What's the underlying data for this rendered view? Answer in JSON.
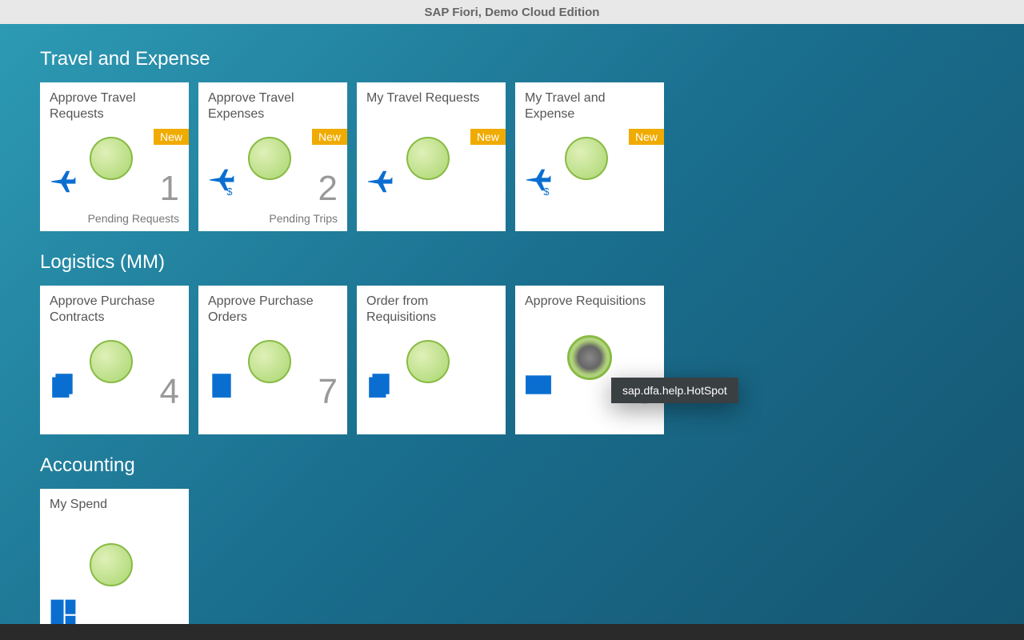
{
  "header": {
    "title": "SAP Fiori, Demo Cloud Edition"
  },
  "tooltip": "sap.dfa.help.HotSpot",
  "groups": [
    {
      "title": "Travel and Expense",
      "tiles": [
        {
          "title": "Approve Travel Requests",
          "badge": "New",
          "count": "1",
          "footer": "Pending Requests",
          "icon": "airplane"
        },
        {
          "title": "Approve Travel Expenses",
          "badge": "New",
          "count": "2",
          "footer": "Pending Trips",
          "icon": "airplane-dollar"
        },
        {
          "title": "My Travel Requests",
          "badge": "New",
          "count": "",
          "footer": "",
          "icon": "airplane"
        },
        {
          "title": "My Travel and Expense",
          "badge": "New",
          "count": "",
          "footer": "",
          "icon": "airplane-dollar"
        }
      ]
    },
    {
      "title": "Logistics (MM)",
      "tiles": [
        {
          "title": "Approve Purchase Contracts",
          "badge": "",
          "count": "4",
          "footer": "",
          "icon": "doc-dollar-stack"
        },
        {
          "title": "Approve Purchase Orders",
          "badge": "",
          "count": "7",
          "footer": "",
          "icon": "doc-dollar"
        },
        {
          "title": "Order from Requisitions",
          "badge": "",
          "count": "",
          "footer": "",
          "icon": "doc-dollar-stack"
        },
        {
          "title": "Approve Requisitions",
          "badge": "",
          "count": "8",
          "footer": "",
          "icon": "barcode",
          "active": true
        }
      ]
    },
    {
      "title": "Accounting",
      "tiles": [
        {
          "title": "My Spend",
          "badge": "",
          "count": "",
          "footer": "",
          "icon": "dashboard"
        }
      ]
    }
  ]
}
